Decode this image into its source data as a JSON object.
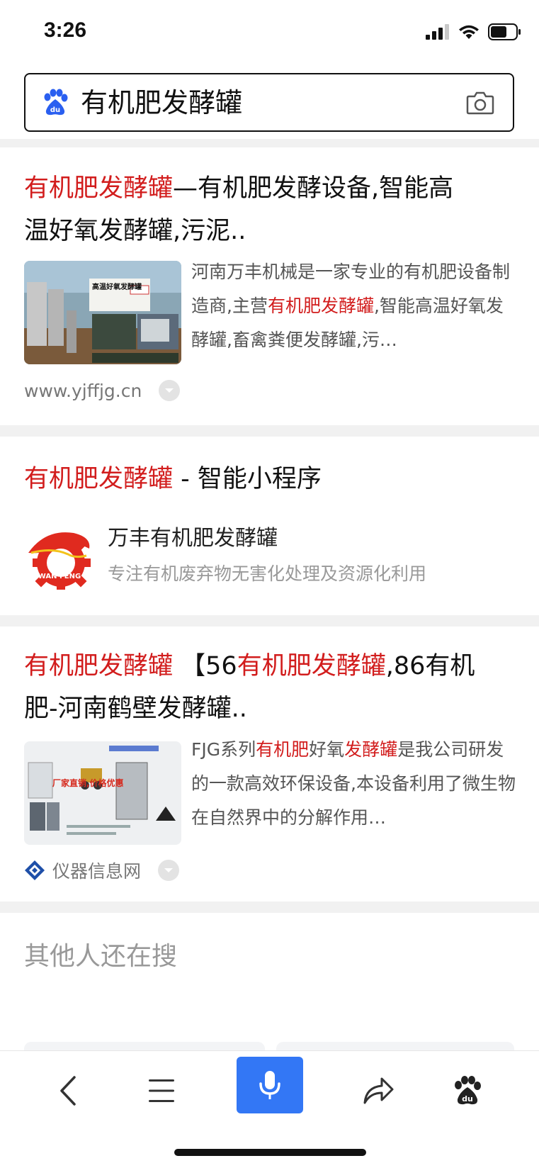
{
  "status_bar": {
    "time": "3:26"
  },
  "search": {
    "query": "有机肥发酵罐"
  },
  "result1": {
    "title_hl": "有机肥发酵罐",
    "title_rest_line1": "—有机肥发酵设备,智能高",
    "title_line2": "温好氧发酵罐,污泥..",
    "abstract_a": "河南万丰机械是一家专业的有机肥设备制造商,主营",
    "abstract_hl": "有机肥发酵罐",
    "abstract_b": ",智能高温好氧发酵罐,畜禽粪便发酵罐,污…",
    "thumb_caption": "高温好氧发酵罐",
    "url": "www.yjffjg.cn"
  },
  "result2": {
    "title_hl": "有机肥发酵罐",
    "title_rest": " - 智能小程序",
    "app_name": "万丰有机肥发酵罐",
    "app_desc": "专注有机废弃物无害化处理及资源化利用",
    "logo_text": "WAN FENG"
  },
  "result3": {
    "title_hl1": "有机肥发酵罐",
    "title_p2": " 【56",
    "title_hl2": "有机肥发酵罐",
    "title_p3": ",86有机",
    "title_line2": "肥-河南鹤壁发酵罐..",
    "abs_p1": "FJG系列",
    "abs_hl1": "有机肥",
    "abs_p2": "好氧",
    "abs_hl2": "发酵罐",
    "abs_p3": "是我公司研发的一款高效环保设备,本设备利用了微生物在自然界中的分解作用…",
    "thumb_caption": "厂家直销,价格优惠",
    "source_name": "仪器信息网"
  },
  "others": {
    "title": "其他人还在搜"
  },
  "colors": {
    "highlight": "#d21d1d",
    "accent": "#3377f5"
  },
  "icons": {
    "nav": [
      "back-arrow-icon",
      "menu-icon",
      "microphone-icon",
      "share-icon",
      "baidu-paw-icon"
    ]
  }
}
